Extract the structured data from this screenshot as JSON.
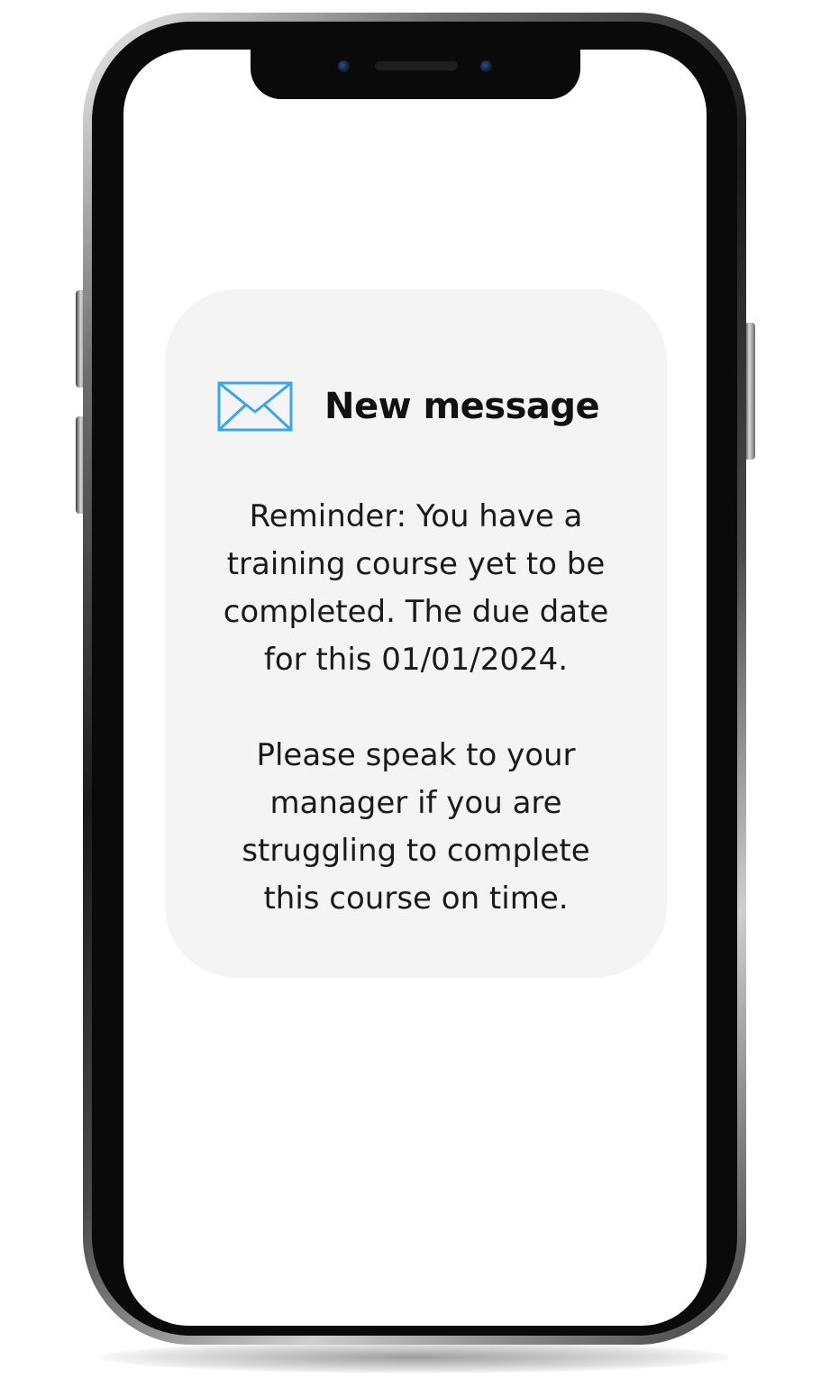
{
  "notification": {
    "icon": "envelope-icon",
    "title": "New message",
    "body_lines": [
      "Reminder: You have a",
      "training course yet to be",
      "completed. The due date",
      "for this 01/01/2024."
    ],
    "body_lines_2": [
      "Please speak to your",
      "manager if you are",
      "struggling to complete",
      "this course on time."
    ]
  },
  "colors": {
    "card_background": "#f4f4f4",
    "icon_stroke": "#3aa6e8",
    "text": "#111111"
  }
}
